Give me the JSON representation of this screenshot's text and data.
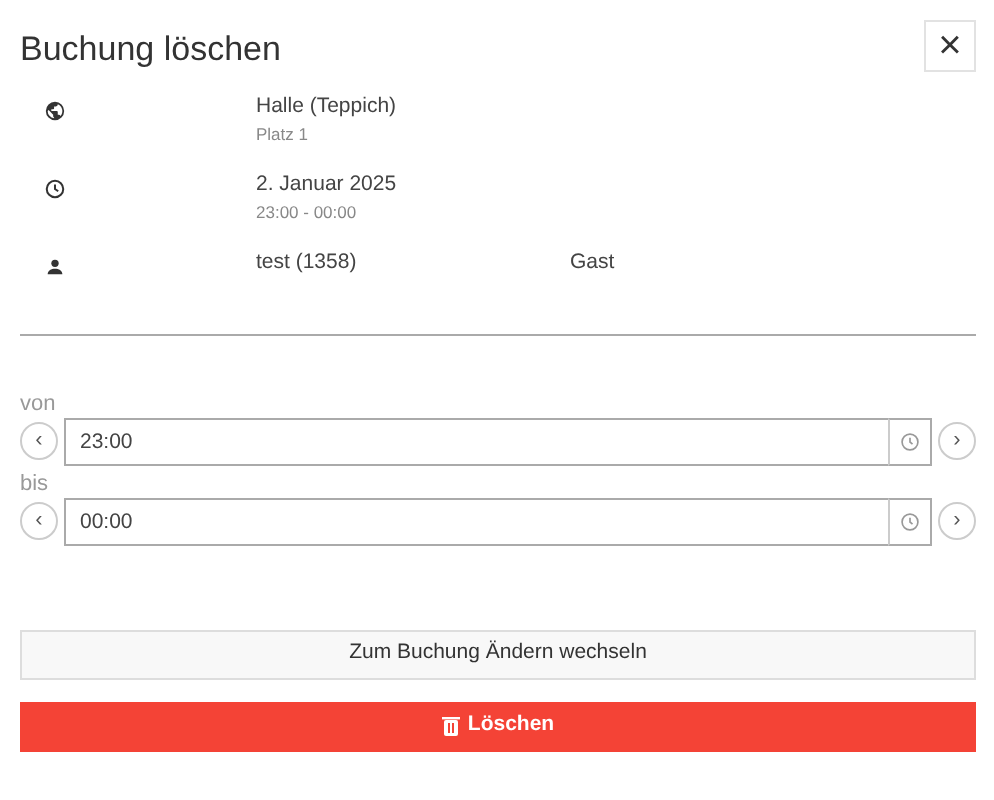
{
  "dialog": {
    "title": "Buchung löschen",
    "close": "×"
  },
  "details": [
    {
      "kind": "place",
      "primary": "Halle (Teppich)",
      "secondary": "Platz 1"
    },
    {
      "kind": "time",
      "primary": "2. Januar 2025",
      "secondary": "23:00 - 00:00"
    },
    {
      "kind": "person",
      "primary": "test (1358)",
      "extra": "Gast"
    }
  ],
  "times": [
    {
      "label": "von",
      "value": "23:00",
      "prev": "‹",
      "next": "›"
    },
    {
      "label": "bis",
      "value": "00:00",
      "prev": "‹",
      "next": "›"
    }
  ],
  "buttons": [
    {
      "kind": "secondary",
      "label": "Zum Buchung Ändern wechseln"
    },
    {
      "kind": "danger",
      "label": "Löschen"
    }
  ]
}
